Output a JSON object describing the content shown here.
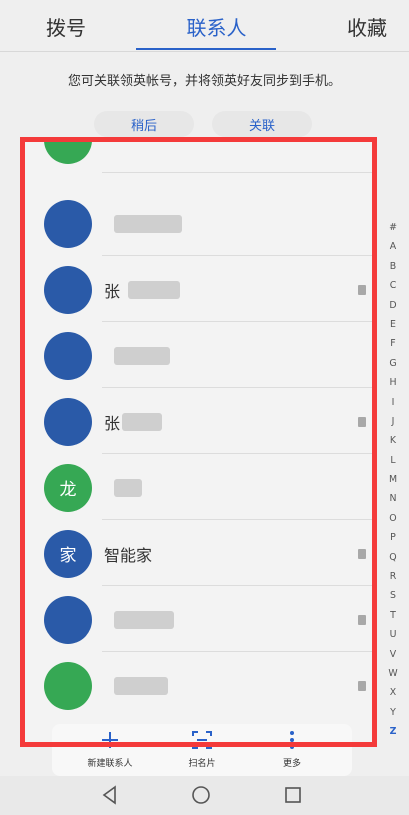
{
  "tabs": [
    {
      "label": "拨号",
      "active": false
    },
    {
      "label": "联系人",
      "active": true
    },
    {
      "label": "收藏",
      "active": false
    }
  ],
  "banner": {
    "message": "您可关联领英帐号，并将领英好友同步到手机。",
    "later_label": "稍后",
    "link_label": "关联"
  },
  "contacts": [
    {
      "avatar_char": "",
      "avatar_color": "green",
      "name": ""
    },
    {
      "avatar_char": "",
      "avatar_color": "blue",
      "name": "",
      "has_card": false
    },
    {
      "avatar_char": "",
      "avatar_color": "blue",
      "name": "张",
      "has_card": true
    },
    {
      "avatar_char": "",
      "avatar_color": "blue",
      "name": "",
      "has_card": false
    },
    {
      "avatar_char": "",
      "avatar_color": "blue",
      "name": "张",
      "has_card": true
    },
    {
      "avatar_char": "龙",
      "avatar_color": "green",
      "name": "",
      "has_card": false
    },
    {
      "avatar_char": "家",
      "avatar_color": "blue",
      "name": "智能家",
      "has_card": true
    },
    {
      "avatar_char": "",
      "avatar_color": "blue",
      "name": "",
      "has_card": true
    },
    {
      "avatar_char": "",
      "avatar_color": "green",
      "name": "",
      "has_card": true
    }
  ],
  "index_letters": [
    "#",
    "A",
    "B",
    "C",
    "D",
    "E",
    "F",
    "G",
    "H",
    "I",
    "J",
    "K",
    "L",
    "M",
    "N",
    "O",
    "P",
    "Q",
    "R",
    "S",
    "T",
    "U",
    "V",
    "W",
    "X",
    "Y",
    "Z"
  ],
  "index_current": "Z",
  "bottom_actions": {
    "new_contact": "新建联系人",
    "scan_card": "扫名片",
    "more": "更多"
  },
  "colors": {
    "accent": "#2a62c9",
    "frame": "#f43a3a",
    "avatar_blue": "#2a5aa8",
    "avatar_green": "#36a854"
  }
}
